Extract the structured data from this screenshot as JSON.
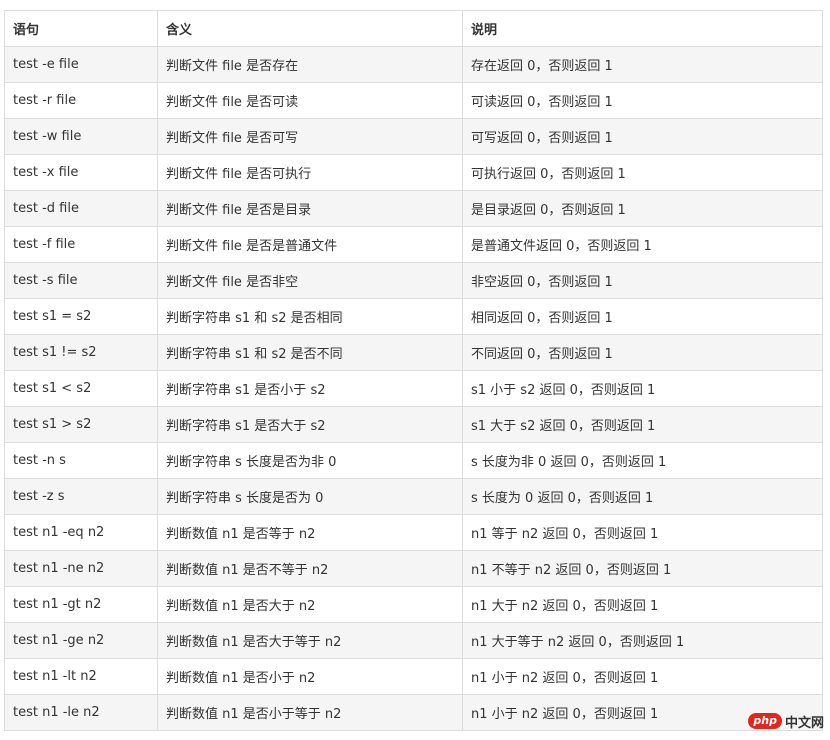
{
  "table": {
    "headers": [
      "语句",
      "含义",
      "说明"
    ],
    "rows": [
      [
        "test -e file",
        "判断文件 file 是否存在",
        "存在返回 0，否则返回 1"
      ],
      [
        "test -r file",
        "判断文件 file 是否可读",
        "可读返回 0，否则返回 1"
      ],
      [
        "test -w file",
        "判断文件 file 是否可写",
        "可写返回 0，否则返回 1"
      ],
      [
        "test -x file",
        "判断文件 file 是否可执行",
        "可执行返回 0，否则返回 1"
      ],
      [
        "test -d file",
        "判断文件 file 是否是目录",
        "是目录返回 0，否则返回 1"
      ],
      [
        "test -f file",
        "判断文件 file 是否是普通文件",
        "是普通文件返回 0，否则返回 1"
      ],
      [
        "test -s file",
        "判断文件 file 是否非空",
        "非空返回 0，否则返回 1"
      ],
      [
        "test s1 = s2",
        "判断字符串 s1 和 s2 是否相同",
        "相同返回 0，否则返回 1"
      ],
      [
        "test s1 != s2",
        "判断字符串 s1 和 s2 是否不同",
        "不同返回 0，否则返回 1"
      ],
      [
        "test s1 < s2",
        "判断字符串 s1 是否小于 s2",
        "s1 小于 s2 返回 0，否则返回 1"
      ],
      [
        "test s1 > s2",
        "判断字符串 s1 是否大于 s2",
        "s1 大于 s2 返回 0，否则返回 1"
      ],
      [
        "test -n s",
        "判断字符串 s 长度是否为非 0",
        "s 长度为非 0 返回 0，否则返回 1"
      ],
      [
        "test -z s",
        "判断字符串 s 长度是否为 0",
        "s 长度为 0 返回 0，否则返回 1"
      ],
      [
        "test n1 -eq n2",
        "判断数值 n1 是否等于 n2",
        "n1 等于 n2 返回 0，否则返回 1"
      ],
      [
        "test n1 -ne n2",
        "判断数值 n1 是否不等于 n2",
        "n1 不等于 n2 返回 0，否则返回 1"
      ],
      [
        "test n1 -gt n2",
        "判断数值 n1 是否大于 n2",
        "n1 大于 n2 返回 0，否则返回 1"
      ],
      [
        "test n1 -ge n2",
        "判断数值 n1 是否大于等于 n2",
        "n1 大于等于 n2 返回 0，否则返回 1"
      ],
      [
        "test n1 -lt n2",
        "判断数值 n1 是否小于 n2",
        "n1 小于 n2 返回 0，否则返回 1"
      ],
      [
        "test n1 -le n2",
        "判断数值 n1 是否小于等于 n2",
        "n1 小于 n2 返回 0，否则返回 1"
      ]
    ]
  },
  "watermark": {
    "logo": "php",
    "text": "中文网"
  },
  "colors": {
    "border": "#dddddd",
    "stripe": "#f5f5f5",
    "text": "#333333",
    "watermark_red": "#e3261e"
  }
}
